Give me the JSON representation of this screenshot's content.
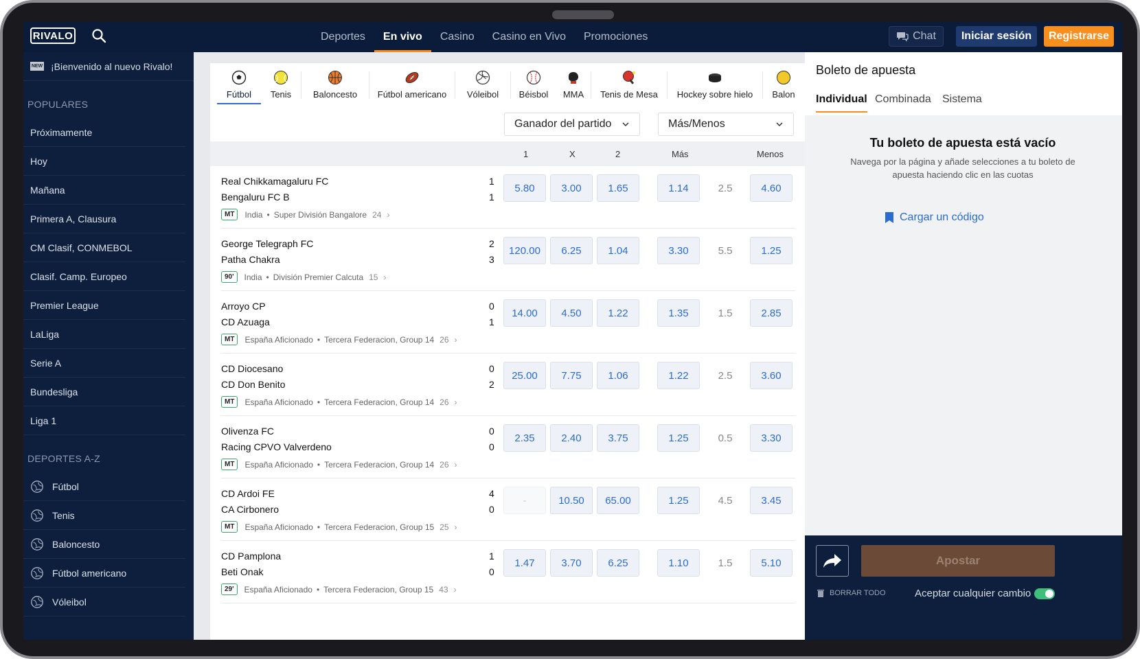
{
  "topnav": {
    "logo": "RIVALO",
    "links": [
      "Deportes",
      "En vivo",
      "Casino",
      "Casino en Vivo",
      "Promociones"
    ],
    "active_link": "En vivo",
    "chat_label": "Chat",
    "login_label": "Iniciar sesión",
    "register_label": "Registrarse"
  },
  "sidebar": {
    "new_badge": "NEW",
    "welcome": "¡Bienvenido al nuevo Rivalo!",
    "popular_title": "POPULARES",
    "popular": [
      "Próximamente",
      "Hoy",
      "Mañana",
      "Primera A, Clausura",
      "CM Clasif, CONMEBOL",
      "Clasif. Camp. Europeo",
      "Premier League",
      "LaLiga",
      "Serie A",
      "Bundesliga",
      "Liga 1"
    ],
    "az_title": "DEPORTES A-Z",
    "az": [
      {
        "label": "Fútbol",
        "icon": "soccer-ball-icon"
      },
      {
        "label": "Tenis",
        "icon": "tennis-ball-icon"
      },
      {
        "label": "Baloncesto",
        "icon": "basketball-icon"
      },
      {
        "label": "Fútbol americano",
        "icon": "american-football-icon"
      },
      {
        "label": "Vóleibol",
        "icon": "volleyball-icon"
      }
    ]
  },
  "sport_tabs": [
    {
      "label": "Fútbol",
      "icon": "soccer-ball-icon",
      "active": true
    },
    {
      "label": "Tenis",
      "icon": "tennis-ball-icon"
    },
    {
      "label": "Baloncesto",
      "icon": "basketball-icon"
    },
    {
      "label": "Fútbol americano",
      "icon": "american-football-icon"
    },
    {
      "label": "Vóleibol",
      "icon": "volleyball-icon"
    },
    {
      "label": "Béisbol",
      "icon": "baseball-icon"
    },
    {
      "label": "MMA",
      "icon": "boxing-glove-icon"
    },
    {
      "label": "Tenis de Mesa",
      "icon": "table-tennis-icon"
    },
    {
      "label": "Hockey sobre hielo",
      "icon": "hockey-puck-icon"
    },
    {
      "label": "Balon",
      "icon": "ball-icon"
    }
  ],
  "markets": {
    "select1": "Ganador del partido",
    "select2": "Más/Menos",
    "col_1": "1",
    "col_x": "X",
    "col_2": "2",
    "col_mas": "Más",
    "col_menos": "Menos"
  },
  "matches": [
    {
      "home": "Real Chikkamagaluru FC",
      "away": "Bengaluru FC B",
      "score_home": "1",
      "score_away": "1",
      "time": "MT",
      "country": "India",
      "league": "Super División Bangalore",
      "count": "24",
      "o1": "5.80",
      "ox": "3.00",
      "o2": "1.65",
      "over": "1.14",
      "line": "2.5",
      "under": "4.60"
    },
    {
      "home": "George Telegraph FC",
      "away": "Patha Chakra",
      "score_home": "2",
      "score_away": "3",
      "time": "90'",
      "country": "India",
      "league": "División Premier Calcuta",
      "count": "15",
      "o1": "120.00",
      "ox": "6.25",
      "o2": "1.04",
      "over": "3.30",
      "line": "5.5",
      "under": "1.25"
    },
    {
      "home": "Arroyo CP",
      "away": "CD Azuaga",
      "score_home": "0",
      "score_away": "1",
      "time": "MT",
      "country": "España Aficionado",
      "league": "Tercera Federacion, Group 14",
      "count": "26",
      "o1": "14.00",
      "ox": "4.50",
      "o2": "1.22",
      "over": "1.35",
      "line": "1.5",
      "under": "2.85"
    },
    {
      "home": "CD Diocesano",
      "away": "CD Don Benito",
      "score_home": "0",
      "score_away": "2",
      "time": "MT",
      "country": "España Aficionado",
      "league": "Tercera Federacion, Group 14",
      "count": "26",
      "o1": "25.00",
      "ox": "7.75",
      "o2": "1.06",
      "over": "1.22",
      "line": "2.5",
      "under": "3.60"
    },
    {
      "home": "Olivenza FC",
      "away": "Racing CPVO Valverdeno",
      "score_home": "0",
      "score_away": "0",
      "time": "MT",
      "country": "España Aficionado",
      "league": "Tercera Federacion, Group 14",
      "count": "26",
      "o1": "2.35",
      "ox": "2.40",
      "o2": "3.75",
      "over": "1.25",
      "line": "0.5",
      "under": "3.30"
    },
    {
      "home": "CD Ardoi FE",
      "away": "CA Cirbonero",
      "score_home": "4",
      "score_away": "0",
      "time": "MT",
      "country": "España Aficionado",
      "league": "Tercera Federacion, Group 15",
      "count": "25",
      "o1": "-",
      "ox": "10.50",
      "o2": "65.00",
      "over": "1.25",
      "line": "4.5",
      "under": "3.45"
    },
    {
      "home": "CD Pamplona",
      "away": "Beti Onak",
      "score_home": "1",
      "score_away": "0",
      "time": "29'",
      "country": "España Aficionado",
      "league": "Tercera Federacion, Group 15",
      "count": "43",
      "o1": "1.47",
      "ox": "3.70",
      "o2": "6.25",
      "over": "1.10",
      "line": "1.5",
      "under": "5.10"
    }
  ],
  "betslip": {
    "title": "Boleto de apuesta",
    "tabs": [
      "Individual",
      "Combinada",
      "Sistema"
    ],
    "empty_title": "Tu boleto de apuesta está vacío",
    "empty_text": "Navega por la página y añade selecciones a tu boleto de apuesta haciendo clic en las cuotas",
    "load_code": "Cargar un código",
    "bet_label": "Apostar",
    "clear_all": "BORRAR TODO",
    "accept_changes": "Aceptar cualquier cambio"
  },
  "colors": {
    "nav_bg": "#0b1c3a",
    "accent": "#f68f1e",
    "odds_blue": "#2a6ccf",
    "toggle_green": "#3ec07a"
  }
}
